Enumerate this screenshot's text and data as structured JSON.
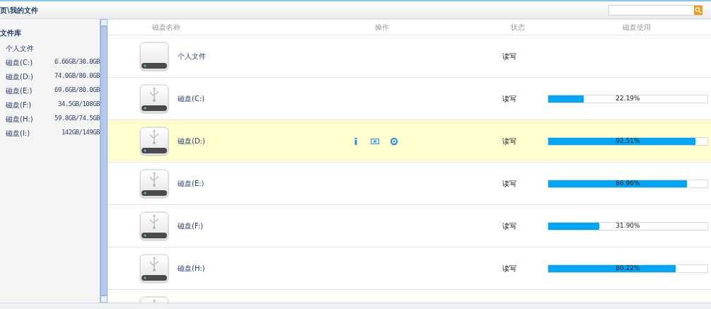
{
  "breadcrumb": "页\\我的文件",
  "sidebar": {
    "title": "文件库",
    "items": [
      {
        "name": "个人文件"
      },
      {
        "name": "磁盘(C:)",
        "usage": "6.66GB/30.0GB"
      },
      {
        "name": "磁盘(D:)",
        "usage": "74.0GB/80.0GB"
      },
      {
        "name": "磁盘(E:)",
        "usage": "69.6GB/80.0GB"
      },
      {
        "name": "磁盘(F:)",
        "usage": "34.5GB/108GB"
      },
      {
        "name": "磁盘(H:)",
        "usage": "59.8GB/74.5GB"
      },
      {
        "name": "磁盘(I:)",
        "usage": "142GB/149GB"
      }
    ]
  },
  "table": {
    "columns": [
      "磁盘名称",
      "操作",
      "状态",
      "磁盘使用"
    ],
    "rows": [
      {
        "kind": "folder",
        "name": "个人文件",
        "status": "读写",
        "selected": false
      },
      {
        "kind": "usb",
        "name": "磁盘(C:)",
        "status": "读写",
        "level": 0.2219,
        "reading": "22.19%",
        "selected": false
      },
      {
        "kind": "usb",
        "name": "磁盘(D:)",
        "status": "读写",
        "level": 0.9251,
        "reading": "92.51%",
        "selected": true
      },
      {
        "kind": "usb",
        "name": "磁盘(E:)",
        "status": "读写",
        "level": 0.8696,
        "reading": "86.96%",
        "selected": false
      },
      {
        "kind": "usb",
        "name": "磁盘(F:)",
        "status": "读写",
        "level": 0.319,
        "reading": "31.90%",
        "selected": false
      },
      {
        "kind": "usb",
        "name": "磁盘(H:)",
        "status": "读写",
        "level": 0.8022,
        "reading": "80.22%",
        "selected": false
      },
      {
        "kind": "usb",
        "selected": false
      }
    ]
  }
}
